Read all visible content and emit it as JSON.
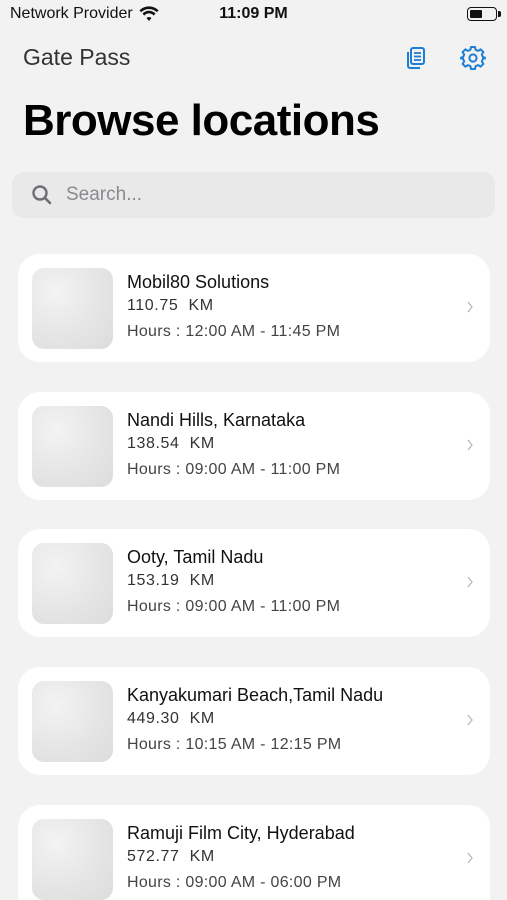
{
  "status_bar": {
    "carrier": "Network Provider",
    "time": "11:09 PM"
  },
  "nav": {
    "title": "Gate Pass",
    "docs_icon": "documents-icon",
    "settings_icon": "gear-icon"
  },
  "page_title": "Browse locations",
  "search": {
    "placeholder": "Search...",
    "value": ""
  },
  "colors": {
    "accent": "#1c7ed6",
    "background": "#f2f2f2",
    "card": "#ffffff"
  },
  "locations": [
    {
      "name": "Mobil80 Solutions",
      "distance": "110.75  KM",
      "hours": "Hours : 12:00 AM - 11:45 PM"
    },
    {
      "name": "Nandi Hills, Karnataka",
      "distance": "138.54  KM",
      "hours": "Hours : 09:00 AM - 11:00 PM"
    },
    {
      "name": "Ooty, Tamil Nadu",
      "distance": "153.19  KM",
      "hours": "Hours : 09:00 AM - 11:00 PM"
    },
    {
      "name": "Kanyakumari Beach,Tamil Nadu",
      "distance": "449.30  KM",
      "hours": "Hours : 10:15 AM - 12:15 PM"
    },
    {
      "name": "Ramuji Film City, Hyderabad",
      "distance": "572.77  KM",
      "hours": "Hours : 09:00 AM - 06:00 PM"
    }
  ]
}
